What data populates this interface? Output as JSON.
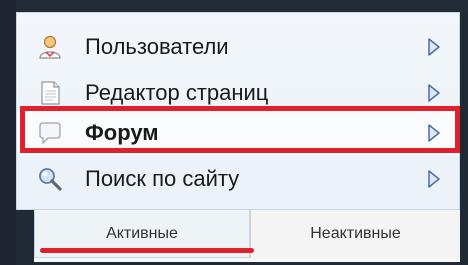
{
  "menu": {
    "items": [
      {
        "label": "Пользователи",
        "icon": "user-icon"
      },
      {
        "label": "Редактор страниц",
        "icon": "page-icon"
      },
      {
        "label": "Форум",
        "icon": "forum-bubble-icon",
        "selected": true
      },
      {
        "label": "Поиск по сайту",
        "icon": "search-icon"
      }
    ]
  },
  "tabs": {
    "active": "Активные",
    "inactive": "Неактивные"
  },
  "colors": {
    "highlight": "#e0202a",
    "panel": "#eaf1f8",
    "arrow": "#4a6fa5"
  }
}
